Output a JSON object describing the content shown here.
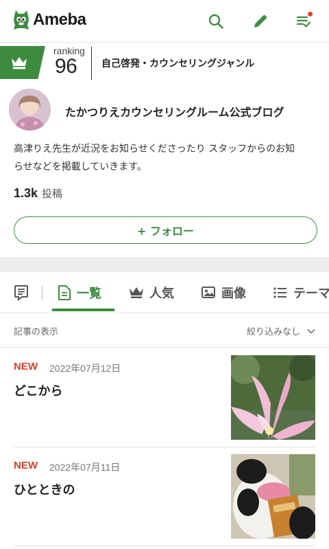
{
  "header": {
    "logo_text": "Ameba",
    "icons": [
      "search-icon",
      "pencil-icon",
      "feed-list-icon"
    ],
    "brand_color": "#3d8b3f",
    "notification_color": "#e8412b"
  },
  "ranking": {
    "label": "ranking",
    "value": "96",
    "genre": "自己啓発・カウンセリングジャンル"
  },
  "profile": {
    "blog_name": "たかつりえカウンセリングルーム公式ブログ",
    "description_line1": "高津りえ先生が近況をお知らせくださったり スタッフからのお知",
    "description_line2": "らせなどを掲載していきます。",
    "posts_count": "1.3k",
    "posts_label": "投稿",
    "follow_label": "+ フォロー"
  },
  "tabs": [
    {
      "label": "",
      "icon": "list-box-icon"
    },
    {
      "label": "一覧",
      "icon": "document-icon",
      "active": true
    },
    {
      "label": "人気",
      "icon": "crown-icon"
    },
    {
      "label": "画像",
      "icon": "image-icon"
    },
    {
      "label": "テーマ",
      "icon": "list-lines-icon"
    }
  ],
  "filter": {
    "label": "記事の表示",
    "selected": "絞り込みなし"
  },
  "entries": [
    {
      "badge": "NEW",
      "date": "2022年07月12日",
      "title": "どこから",
      "thumb": "flower-photo"
    },
    {
      "badge": "NEW",
      "date": "2022年07月11日",
      "title": "ひとときの",
      "thumb": "plush-toy-photo"
    }
  ]
}
